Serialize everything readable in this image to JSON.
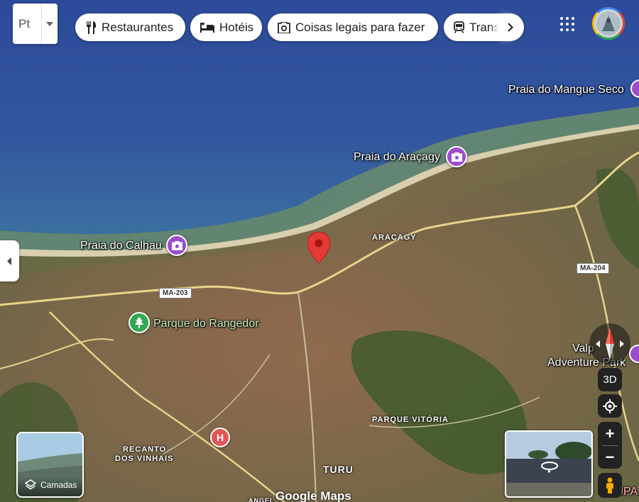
{
  "search_box": {
    "text": "Pt"
  },
  "chips": [
    {
      "label": "Restaurantes",
      "icon": "fork-knife-icon"
    },
    {
      "label": "Hotéis",
      "icon": "bed-icon"
    },
    {
      "label": "Coisas legais para fazer",
      "icon": "camera-icon"
    },
    {
      "label": "Trans",
      "icon": "train-icon"
    }
  ],
  "places": {
    "mangue_seco": "Praia do Mangue Seco",
    "aracagy_beach": "Praia do Araçagy",
    "calhau": "Praia do Calhau",
    "rangedor": "Parque do Rangedor",
    "adventure_line1": "Valp",
    "adventure_line2": "Adventure Park",
    "jpa": "JPA"
  },
  "areas": {
    "aracagy": "ARAÇAGY",
    "parque_vitoria": "PARQUE VITÓRIA",
    "recanto_line1": "RECANTO",
    "recanto_line2": "DOS VINHAIS",
    "turu": "TURU",
    "angel": "ANGEL"
  },
  "roads": {
    "ma203": "MA-203",
    "ma204": "MA-204"
  },
  "controls": {
    "layers_label": "Camadas",
    "three_d": "3D",
    "zoom_in": "+",
    "zoom_out": "−"
  },
  "attribution": "Google Maps",
  "colors": {
    "sea": "#2f4f9a",
    "pin": "#e53935",
    "poi_purple": "#9c4dcc",
    "poi_green": "#34a853",
    "hospital": "#e15656"
  }
}
